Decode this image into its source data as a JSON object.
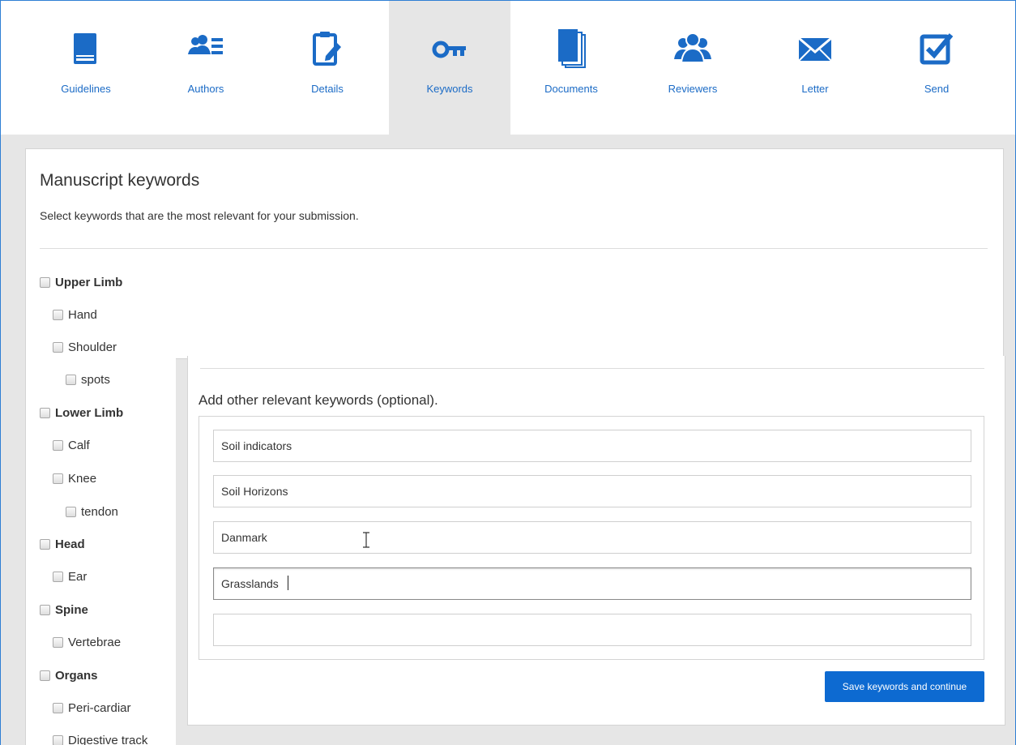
{
  "steps": [
    {
      "label": "Guidelines",
      "icon": "book-icon"
    },
    {
      "label": "Authors",
      "icon": "authors-list-icon"
    },
    {
      "label": "Details",
      "icon": "clipboard-edit-icon"
    },
    {
      "label": "Keywords",
      "icon": "key-icon"
    },
    {
      "label": "Documents",
      "icon": "documents-stack-icon"
    },
    {
      "label": "Reviewers",
      "icon": "users-group-icon"
    },
    {
      "label": "Letter",
      "icon": "envelope-icon"
    },
    {
      "label": "Send",
      "icon": "checkbox-edit-icon"
    }
  ],
  "active_step": "Keywords",
  "keywords_section": {
    "title": "Manuscript keywords",
    "subtitle": "Select keywords that are the most relevant for your submission."
  },
  "keyword_tree": [
    {
      "label": "Upper Limb",
      "level": 0,
      "checked": false
    },
    {
      "label": "Hand",
      "level": 1,
      "checked": false
    },
    {
      "label": "Shoulder",
      "level": 1,
      "checked": false
    },
    {
      "label": "spots",
      "level": 2,
      "checked": false
    },
    {
      "label": "Lower Limb",
      "level": 0,
      "checked": false
    },
    {
      "label": "Calf",
      "level": 1,
      "checked": false
    },
    {
      "label": "Knee",
      "level": 1,
      "checked": false
    },
    {
      "label": "tendon",
      "level": 2,
      "checked": false
    },
    {
      "label": "Head",
      "level": 0,
      "checked": false
    },
    {
      "label": "Ear",
      "level": 1,
      "checked": false
    },
    {
      "label": "Spine",
      "level": 0,
      "checked": false
    },
    {
      "label": "Vertebrae",
      "level": 1,
      "checked": false
    },
    {
      "label": "Organs",
      "level": 0,
      "checked": false
    },
    {
      "label": "Peri-cardiar",
      "level": 1,
      "checked": false
    },
    {
      "label": "Digestive track",
      "level": 1,
      "checked": false
    }
  ],
  "other_keywords": {
    "title": "Add other relevant keywords (optional).",
    "inputs": [
      "Soil indicators",
      "Soil Horizons",
      "Danmark",
      "Grasslands",
      ""
    ],
    "focused_input": 4
  },
  "save_button": "Save keywords and continue",
  "colors": {
    "accent": "#1b6bc6",
    "button": "#0d6ad1",
    "frame_border": "#2f7fd4",
    "background": "#e6e6e6"
  }
}
